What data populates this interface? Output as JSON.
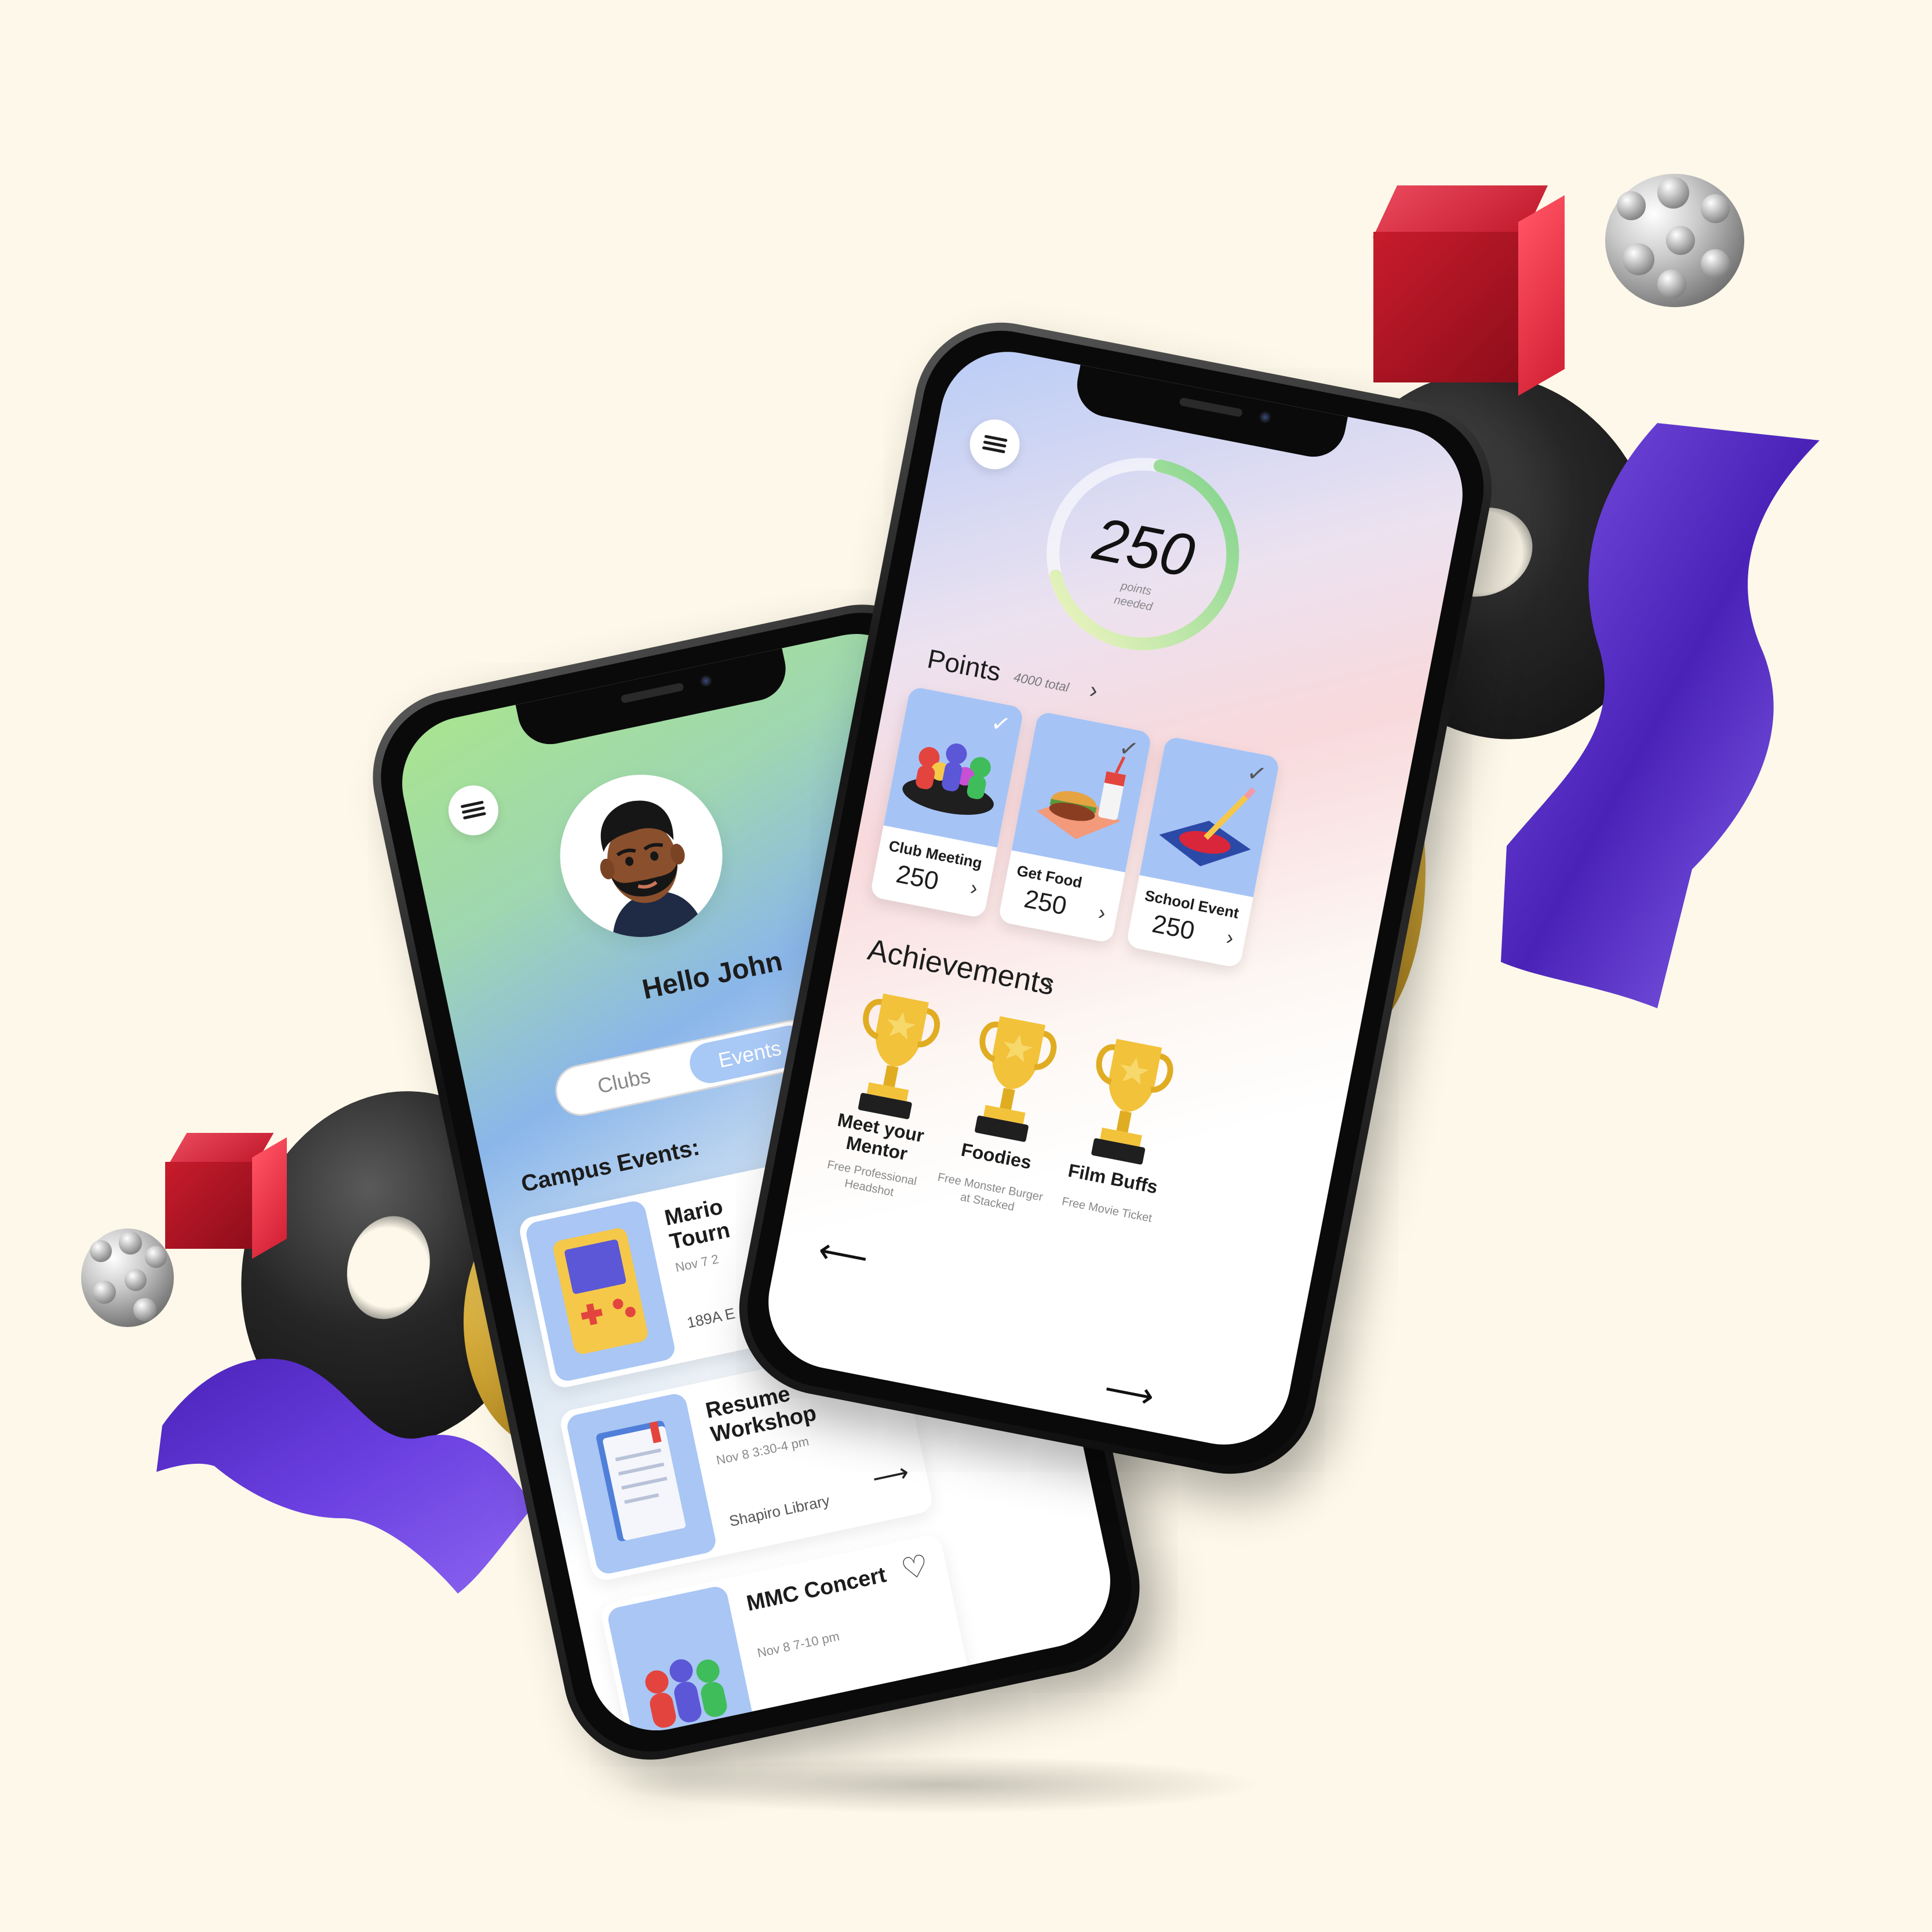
{
  "profile_phone": {
    "greeting": "Hello John",
    "tabs": [
      {
        "label": "Clubs",
        "active": false
      },
      {
        "label": "Events",
        "active": true
      }
    ],
    "section_title": "Campus Events:",
    "events": [
      {
        "name": "Mario Kart Tournament",
        "name_visible": "Mario\nTourn",
        "time": "Nov 7  2",
        "location": "189A E"
      },
      {
        "name": "Resume Workshop",
        "time": "Nov 8  3:30-4 pm",
        "location": "Shapiro Library",
        "favorited": true
      },
      {
        "name": "MMC Concert",
        "time": "Nov 8  7-10 pm",
        "favorited": false
      }
    ]
  },
  "points_phone": {
    "points_value": "250",
    "points_caption": "points needed",
    "points_progress": 0.68,
    "points_heading": "Points",
    "points_total": "4000 total",
    "tasks": [
      {
        "label": "Club Meeting",
        "points": "250",
        "completed": true
      },
      {
        "label": "Get Food",
        "points": "250",
        "completed": true
      },
      {
        "label": "School Event",
        "points": "250",
        "completed": true
      }
    ],
    "achievements_heading": "Achievements",
    "achievements": [
      {
        "name": "Meet your Mentor",
        "reward": "Free Professional Headshot"
      },
      {
        "name": "Foodies",
        "reward": "Free Monster Burger at Stacked"
      },
      {
        "name": "Film Buffs",
        "reward": "Free Movie Ticket"
      }
    ]
  },
  "colors": {
    "background": "#fdf8e9",
    "accent_blue": "#a8c8f5",
    "gauge_green": "#7ed38b",
    "heart_red": "#d9263b",
    "ribbon_purple": "#5b2fc9",
    "cube_red": "#c81c2c"
  }
}
